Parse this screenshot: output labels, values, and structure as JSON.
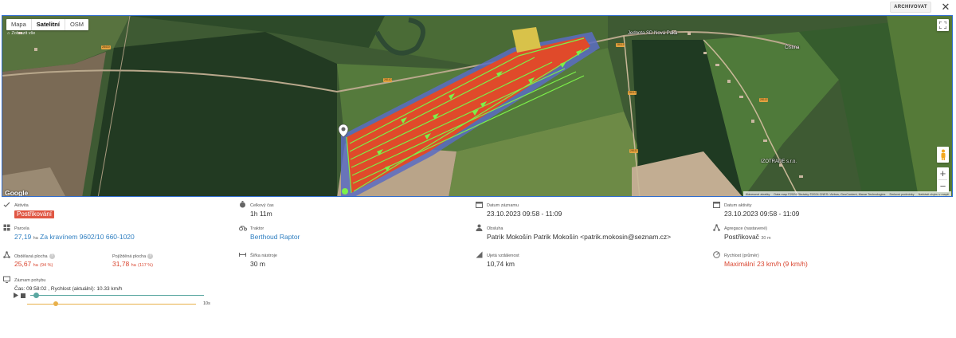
{
  "header": {
    "archive_label": "ARCHIVOVAT",
    "close_glyph": "✕"
  },
  "map": {
    "tabs": [
      {
        "label": "Mapa"
      },
      {
        "label": "Satelitní"
      },
      {
        "label": "OSM"
      }
    ],
    "side_label": "Zobrazit vše",
    "pois": [
      "Jednota SD Nová Paka",
      "Čistina",
      "IZOTRADE s.r.o."
    ],
    "roads": [
      "28410",
      "28113",
      "28113",
      "28113",
      "28113",
      "28110"
    ],
    "google_logo": "Google",
    "attribution": [
      "Klávesové zkratky",
      "Data map ©2024 Obrázky ©2024 CNES / Airbus, GeoContent, Maxar Technologies",
      "Smluvní podmínky",
      "Nahlásit chybu v mapě"
    ]
  },
  "details": {
    "activity": {
      "label": "Aktivita",
      "value": "Postřikování"
    },
    "total_time": {
      "label": "Celkový čas",
      "value": "1h 11m"
    },
    "record_date": {
      "label": "Datum záznamu",
      "value": "23.10.2023 09:58 - 11:09"
    },
    "activity_date": {
      "label": "Datum aktivity",
      "value": "23.10.2023 09:58 - 11:09"
    },
    "parcel": {
      "label": "Parcela",
      "area": "27,19",
      "unit": "ha",
      "name": "Za kravínem 9602/10 660-1020"
    },
    "tractor": {
      "label": "Traktor",
      "value": "Berthoud Raptor"
    },
    "operator": {
      "label": "Obsluha",
      "value": "Patrik Mokošín Patrik Mokošín <patrik.mokosin@seznam.cz>"
    },
    "aggregate": {
      "label": "Agregace (nastavené)",
      "value": "Postřikovač",
      "suffix": "30 m"
    },
    "worked_area": {
      "label": "Obdělaná plocha",
      "value": "25,67",
      "unit": "ha",
      "percent": "(94 %)"
    },
    "driven_area": {
      "label": "Pojížděná plocha",
      "value": "31,78",
      "unit": "ha",
      "percent": "(117 %)"
    },
    "tool_width": {
      "label": "Šířka nástroje",
      "value": "30 m"
    },
    "distance": {
      "label": "Ujetá vzdálenost",
      "value": "10,74 km"
    },
    "speed": {
      "label": "Rychlost (průměr)",
      "value": "Maximální 23 km/h (9 km/h)"
    }
  },
  "recording": {
    "label": "Záznam pohybu",
    "current": "Čas: 09:58:02 , Rychlost (aktuální): 10.33 km/h",
    "playback_speed": "10s",
    "progress": 0.02,
    "speed_position": 0.16
  },
  "colors": {
    "accent": "#2f7fc1",
    "danger": "#d9452f",
    "field_fill": "#e04a2a",
    "track": "#7cf04a"
  }
}
